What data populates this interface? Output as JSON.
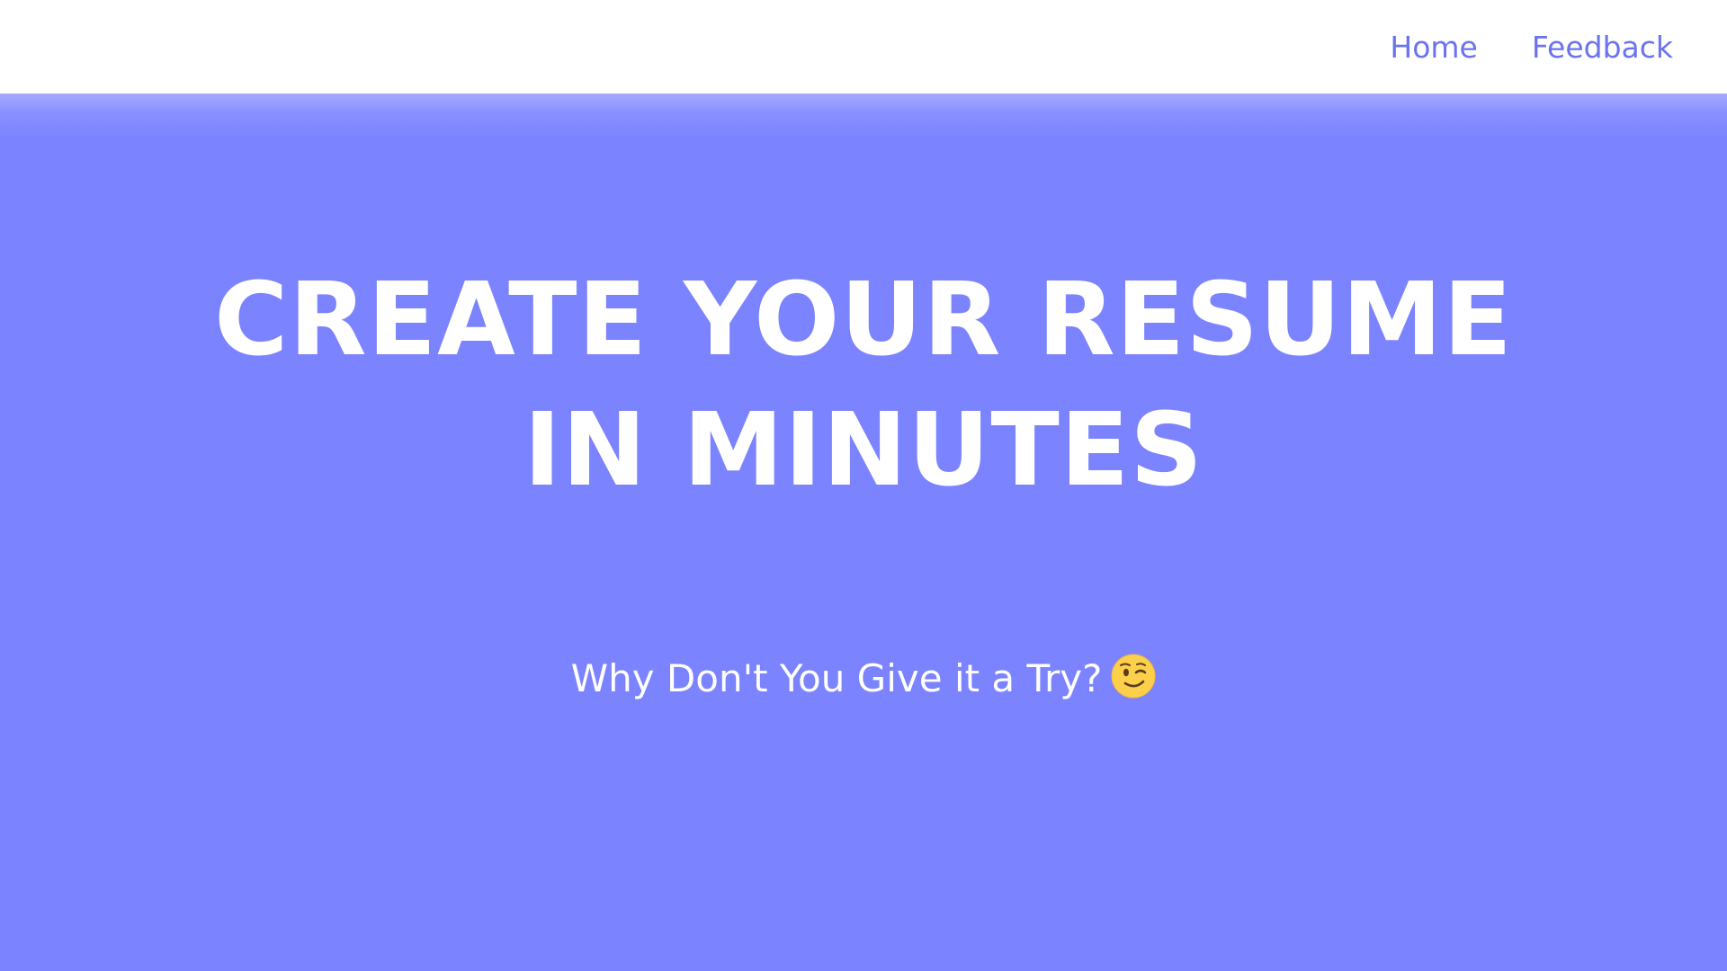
{
  "nav": {
    "links": [
      {
        "label": "Home"
      },
      {
        "label": "Feedback"
      }
    ]
  },
  "hero": {
    "title": "CREATE YOUR RESUME IN MINUTES",
    "subtitle": "Why Don't You Give it a Try?",
    "emoji_icon": "winking-face-icon"
  },
  "colors": {
    "accent": "#7b83ff",
    "nav_link": "#6b73ef",
    "nav_background": "#ffffff",
    "hero_text": "#ffffff"
  }
}
